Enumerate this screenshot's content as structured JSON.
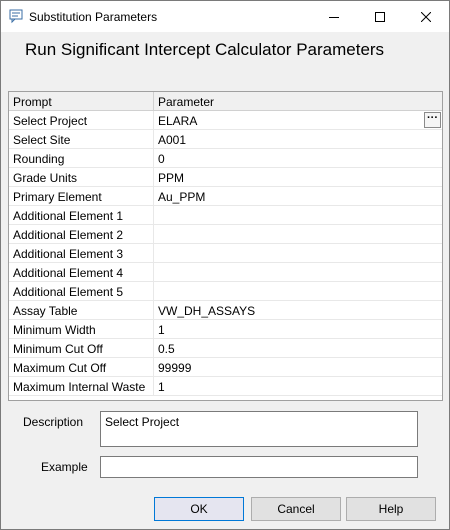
{
  "window": {
    "title": "Substitution Parameters",
    "heading": "Run Significant Intercept Calculator Parameters"
  },
  "grid": {
    "columns": [
      "Prompt",
      "Parameter"
    ],
    "rows": [
      {
        "prompt": "Select Project",
        "parameter": "ELARA",
        "has_browse": true
      },
      {
        "prompt": "Select Site",
        "parameter": "A001"
      },
      {
        "prompt": "Rounding",
        "parameter": "0"
      },
      {
        "prompt": "Grade Units",
        "parameter": "PPM"
      },
      {
        "prompt": "Primary Element",
        "parameter": "Au_PPM"
      },
      {
        "prompt": "Additional Element 1",
        "parameter": ""
      },
      {
        "prompt": "Additional Element 2",
        "parameter": ""
      },
      {
        "prompt": "Additional Element 3",
        "parameter": ""
      },
      {
        "prompt": "Additional Element 4",
        "parameter": ""
      },
      {
        "prompt": "Additional Element 5",
        "parameter": ""
      },
      {
        "prompt": "Assay Table",
        "parameter": "VW_DH_ASSAYS"
      },
      {
        "prompt": "Minimum Width",
        "parameter": "1"
      },
      {
        "prompt": "Minimum Cut Off",
        "parameter": "0.5"
      },
      {
        "prompt": "Maximum Cut Off",
        "parameter": "99999"
      },
      {
        "prompt": "Maximum Internal Waste",
        "parameter": "1"
      }
    ],
    "browse_label": "···"
  },
  "description": {
    "label": "Description",
    "value": "Select Project"
  },
  "example": {
    "label": "Example",
    "value": ""
  },
  "buttons": {
    "ok": "OK",
    "cancel": "Cancel",
    "help": "Help"
  }
}
